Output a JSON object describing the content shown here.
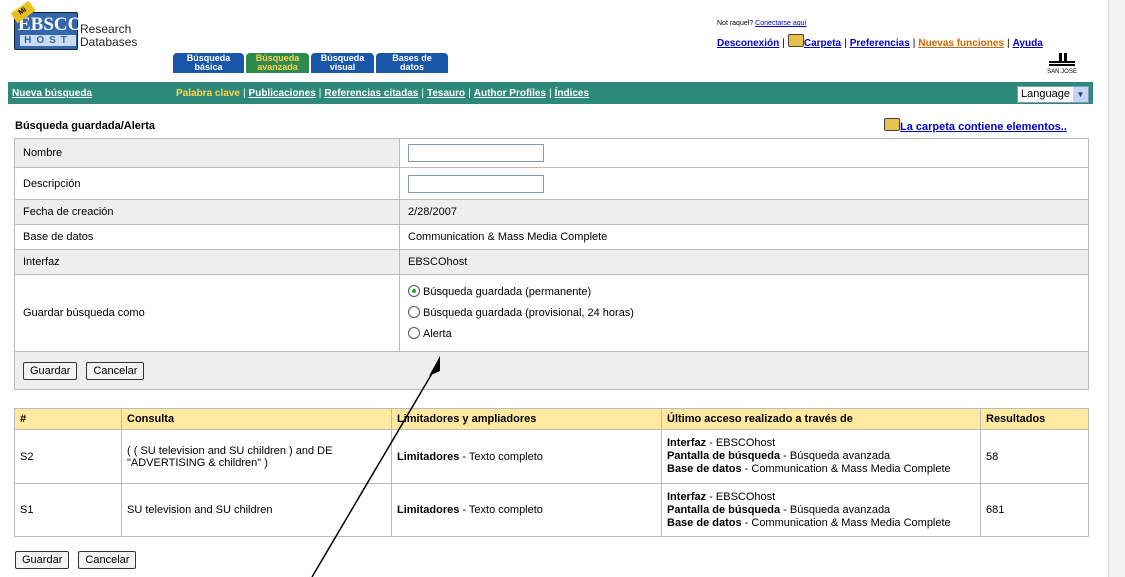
{
  "brand": {
    "logo_text": "EBSCO",
    "logo_sub": "HOST",
    "badge": "Mi",
    "line1": "Research",
    "line2": "Databases"
  },
  "tabs": [
    {
      "line1": "Búsqueda",
      "line2": "básica",
      "active": false
    },
    {
      "line1": "Búsqueda",
      "line2": "avanzada",
      "active": true
    },
    {
      "line1": "Búsqueda",
      "line2": "visual",
      "active": false
    },
    {
      "line1": "Bases de",
      "line2": "datos",
      "active": false
    }
  ],
  "top": {
    "notice": "Not raquel?",
    "connect_link": "Conectarse aquí",
    "disconnect": "Desconexión",
    "folder": "Carpeta",
    "prefs": "Preferencias",
    "new_features": "Nuevas funciones",
    "help": "Ayuda",
    "right_logo": "SAN JOSE"
  },
  "nav": {
    "new_search": "Nueva búsqueda",
    "items": [
      "Palabra clave",
      "Publicaciones",
      "Referencias citadas",
      "Tesauro",
      "Author Profiles",
      "Índices"
    ],
    "language": "Language"
  },
  "section": {
    "title": "Búsqueda guardada/Alerta",
    "folder_notice": "La carpeta contiene elementos.."
  },
  "form": {
    "name_label": "Nombre",
    "desc_label": "Descripción",
    "date_label": "Fecha de creación",
    "date_value": "2/28/2007",
    "db_label": "Base de datos",
    "db_value": "Communication & Mass Media Complete",
    "iface_label": "Interfaz",
    "iface_value": "EBSCOhost",
    "save_as_label": "Guardar búsqueda como",
    "options": [
      "Búsqueda guardada (permanente)",
      "Búsqueda guardada (provisional, 24 horas)",
      "Alerta"
    ],
    "selected": 0,
    "save": "Guardar",
    "cancel": "Cancelar"
  },
  "history": {
    "headers": [
      "#",
      "Consulta",
      "Limitadores y ampliadores",
      "Último acceso realizado a través de",
      "Resultados"
    ],
    "rows": [
      {
        "id": "S2",
        "query": "( ( SU television and SU children ) and DE \"ADVERTISING & children\" )",
        "lim_label": "Limitadores",
        "lim_value": " - Texto completo",
        "results": "58"
      },
      {
        "id": "S1",
        "query": "SU television and SU children",
        "lim_label": "Limitadores",
        "lim_value": " - Texto completo",
        "results": "681"
      }
    ],
    "access": {
      "iface_label": "Interfaz",
      "iface_value": " - EBSCOhost",
      "screen_label": "Pantalla de búsqueda",
      "screen_value": " - Búsqueda avanzada",
      "db_label": "Base de datos",
      "db_value": " - Communication & Mass Media Complete"
    }
  },
  "bottom": {
    "save": "Guardar",
    "cancel": "Cancelar"
  }
}
